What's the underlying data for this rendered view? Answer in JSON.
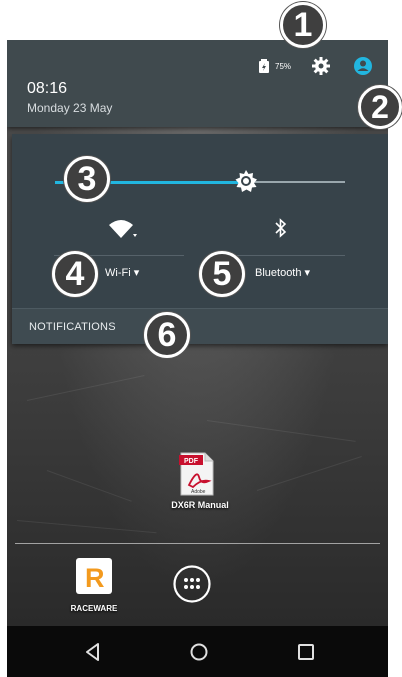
{
  "status": {
    "time": "08:16",
    "date": "Monday 23 May",
    "battery": "75%"
  },
  "quick_settings": {
    "brightness_level": 0.66,
    "wifi_label": "Wi-Fi ▾",
    "bluetooth_label": "Bluetooth ▾",
    "notifications_label": "NOTIFICATIONS"
  },
  "desktop": {
    "pdf_badge": "PDF",
    "pdf_brand": "Adobe",
    "pdf_label": "DX6R Manual",
    "raceware_letter": "R",
    "raceware_label": "RACEWARE"
  },
  "callouts": [
    "1",
    "2",
    "3",
    "4",
    "5",
    "6"
  ],
  "colors": {
    "accent": "#21b6e0",
    "panel": "#37434a",
    "header": "#404a4e"
  },
  "icons": [
    "battery-icon",
    "gear-icon",
    "user-icon",
    "brightness-icon",
    "wifi-icon",
    "bluetooth-icon",
    "back-icon",
    "home-icon",
    "recent-icon",
    "apps-grid-icon"
  ]
}
